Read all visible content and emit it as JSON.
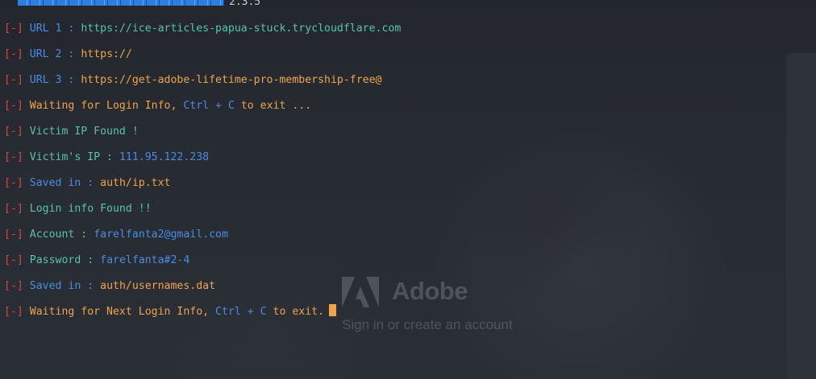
{
  "banner": {
    "version": "2.3.5"
  },
  "bracket": "[-]",
  "lines": [
    {
      "label": "URL 1 : ",
      "value": "https://ice-articles-papua-stuck.trycloudflare.com"
    },
    {
      "label": "URL 2 : ",
      "value": "https://"
    },
    {
      "label": "URL 3 : ",
      "value": "https://get-adobe-lifetime-pro-membership-free@"
    },
    {
      "text_a": "Waiting for Login Info, ",
      "text_b": "Ctrl + C",
      "text_c": " to exit ..."
    },
    {
      "text": "Victim IP Found !"
    },
    {
      "label": "Victim's IP : ",
      "value": "111.95.122.238"
    },
    {
      "label": "Saved in : ",
      "value": "auth/ip.txt"
    },
    {
      "text": "Login info Found !!"
    },
    {
      "label": "Account : ",
      "value": "farelfanta2@gmail.com"
    },
    {
      "label": "Password : ",
      "value": "farelfanta#2-4"
    },
    {
      "label": "Saved in : ",
      "value": "auth/usernames.dat"
    },
    {
      "text_a": "Waiting for Next Login Info, ",
      "text_b": "Ctrl + C",
      "text_c": " to exit."
    }
  ],
  "watermark": {
    "brand": "Adobe",
    "subtitle": "Sign in or create an account"
  },
  "colors": {
    "background": "#262a31",
    "bracket": "#e0443a",
    "blue": "#4a8be3",
    "orange": "#f0a34b",
    "cyan": "#59c2ab",
    "banner": "#2f7fe0"
  }
}
